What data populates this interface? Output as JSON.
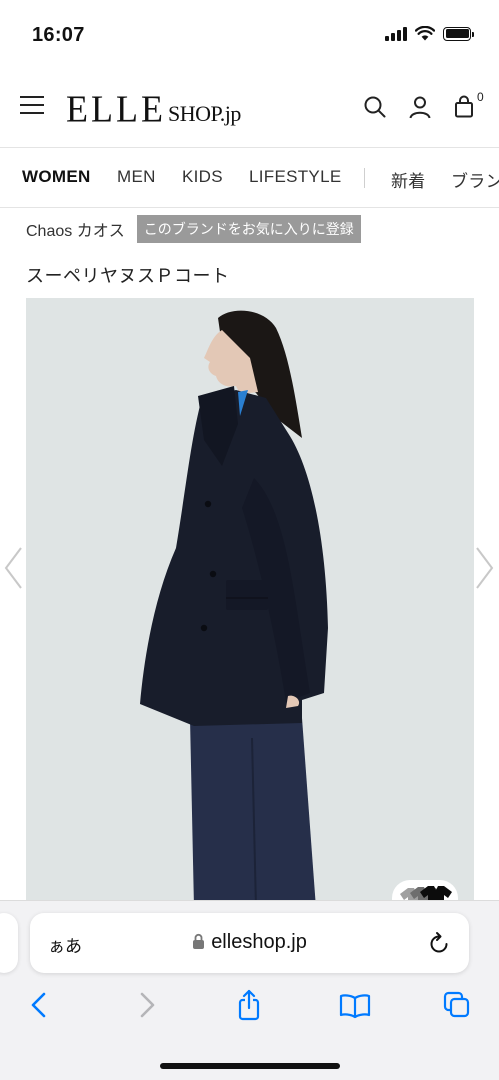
{
  "status_bar": {
    "time": "16:07"
  },
  "header": {
    "logo_main": "ELLE",
    "logo_sub": "SHOP.jp",
    "cart_count": "0"
  },
  "categories": [
    "WOMEN",
    "MEN",
    "KIDS",
    "LIFESTYLE",
    "新着",
    "ブラン"
  ],
  "brand": {
    "name": "Chaos カオス",
    "favorite_label": "このブランドをお気に入りに登録"
  },
  "product": {
    "title": "スーペリヤヌスＰコート"
  },
  "browser": {
    "text_size_label": "ぁあ",
    "url": "elleshop.jp"
  },
  "colors": {
    "accent": "#007aff",
    "image_bg": "#dfe4e4",
    "coat": "#1a1f2e",
    "pants": "#2a3350"
  }
}
